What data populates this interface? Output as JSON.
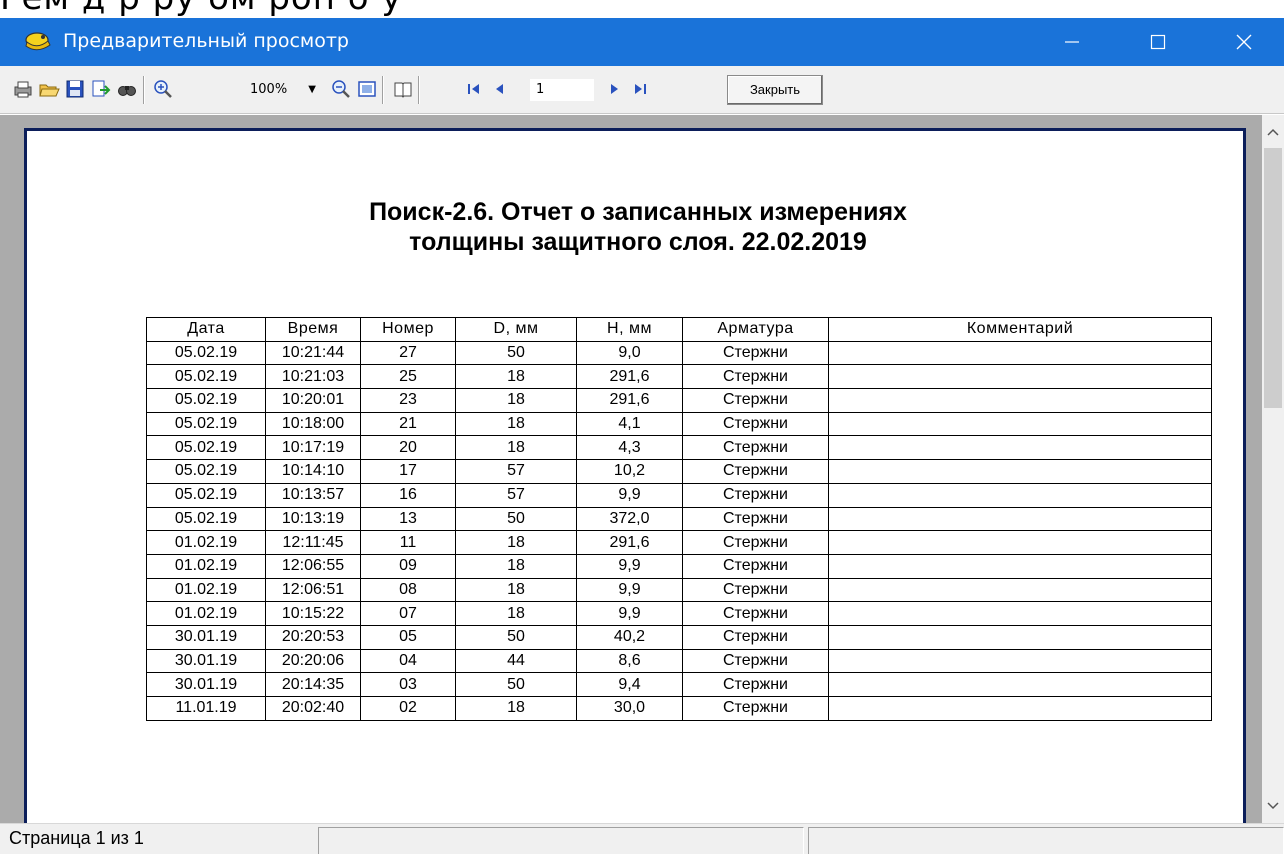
{
  "top_strip": {
    "text": "Рем  д  р  ру  ом  роп   о   у"
  },
  "window": {
    "title": "Предварительный просмотр"
  },
  "toolbar": {
    "zoom_value": "100%",
    "page_number": "1",
    "close_label": "Закрыть"
  },
  "report": {
    "title_line1": "Поиск-2.6. Отчет о записанных измерениях",
    "title_line2": "толщины защитного слоя.  22.02.2019",
    "columns": [
      "Дата",
      "Время",
      "Номер",
      "D, мм",
      "H, мм",
      "Арматура",
      "Комментарий"
    ],
    "rows": [
      [
        "05.02.19",
        "10:21:44",
        "27",
        "50",
        "9,0",
        "Стержни",
        ""
      ],
      [
        "05.02.19",
        "10:21:03",
        "25",
        "18",
        "291,6",
        "Стержни",
        ""
      ],
      [
        "05.02.19",
        "10:20:01",
        "23",
        "18",
        "291,6",
        "Стержни",
        ""
      ],
      [
        "05.02.19",
        "10:18:00",
        "21",
        "18",
        "4,1",
        "Стержни",
        ""
      ],
      [
        "05.02.19",
        "10:17:19",
        "20",
        "18",
        "4,3",
        "Стержни",
        ""
      ],
      [
        "05.02.19",
        "10:14:10",
        "17",
        "57",
        "10,2",
        "Стержни",
        ""
      ],
      [
        "05.02.19",
        "10:13:57",
        "16",
        "57",
        "9,9",
        "Стержни",
        ""
      ],
      [
        "05.02.19",
        "10:13:19",
        "13",
        "50",
        "372,0",
        "Стержни",
        ""
      ],
      [
        "01.02.19",
        "12:11:45",
        "11",
        "18",
        "291,6",
        "Стержни",
        ""
      ],
      [
        "01.02.19",
        "12:06:55",
        "09",
        "18",
        "9,9",
        "Стержни",
        ""
      ],
      [
        "01.02.19",
        "12:06:51",
        "08",
        "18",
        "9,9",
        "Стержни",
        ""
      ],
      [
        "01.02.19",
        "10:15:22",
        "07",
        "18",
        "9,9",
        "Стержни",
        ""
      ],
      [
        "30.01.19",
        "20:20:53",
        "05",
        "50",
        "40,2",
        "Стержни",
        ""
      ],
      [
        "30.01.19",
        "20:20:06",
        "04",
        "44",
        "8,6",
        "Стержни",
        ""
      ],
      [
        "30.01.19",
        "20:14:35",
        "03",
        "50",
        "9,4",
        "Стержни",
        ""
      ],
      [
        "11.01.19",
        "20:02:40",
        "02",
        "18",
        "30,0",
        "Стержни",
        ""
      ]
    ]
  },
  "status": {
    "page_info": "Страница 1 из 1"
  },
  "colors": {
    "titlebar": "#1a73d9",
    "page_border": "#0c1e5a",
    "preview_bg": "#ababab"
  }
}
